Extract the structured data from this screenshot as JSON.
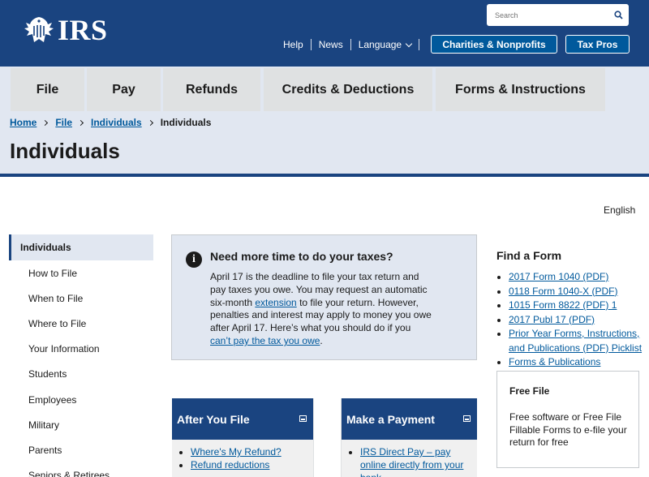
{
  "header": {
    "logo_text": "IRS",
    "search_placeholder": "Search",
    "utility_nav": [
      "Help",
      "News",
      "Language"
    ],
    "buttons": [
      "Charities & Nonprofits",
      "Tax Pros"
    ]
  },
  "main_nav": [
    "File",
    "Pay",
    "Refunds",
    "Credits & Deductions",
    "Forms & Instructions"
  ],
  "breadcrumb": [
    "Home",
    "File",
    "Individuals",
    "Individuals"
  ],
  "page_title": "Individuals",
  "language_link": "English",
  "sidebar": {
    "active": "Individuals",
    "items": [
      "How to File",
      "When to File",
      "Where to File",
      "Your Information",
      "Students",
      "Employees",
      "Military",
      "Parents",
      "Seniors & Retirees"
    ]
  },
  "alert": {
    "title": "Need more time to do your taxes?",
    "text_1": "April 17 is the deadline to file your tax return and pay taxes you owe. You may request an automatic six-month ",
    "link_1": "extension",
    "text_2": " to file your return. However, penalties and interest may apply to money you owe after April 17. Here’s what you should do if you ",
    "link_2": "can’t pay the tax you owe",
    "text_3": "."
  },
  "cards": [
    {
      "title": "After You File",
      "links": [
        "Where's My Refund?",
        "Refund reductions"
      ]
    },
    {
      "title": "Make a Payment",
      "links": [
        "IRS Direct Pay – pay online directly from your bank"
      ]
    }
  ],
  "find_form": {
    "title": "Find a Form",
    "links": [
      "2017 Form 1040 (PDF)",
      "0118 Form 1040-X (PDF)",
      "1015 Form 8822 (PDF) 1",
      "2017 Publ 17 (PDF)",
      "Prior Year Forms, Instructions, and Publications (PDF) Picklist",
      "Forms & Publications"
    ]
  },
  "free_file": {
    "title": "Free File",
    "text": "Free software or Free File Fillable Forms to e-file your return for free"
  },
  "colors": {
    "header_blue": "#1a4480",
    "link_blue": "#00599c",
    "tab_gray": "#dfe1e2",
    "light_blue_bg": "#e1e7f1"
  }
}
